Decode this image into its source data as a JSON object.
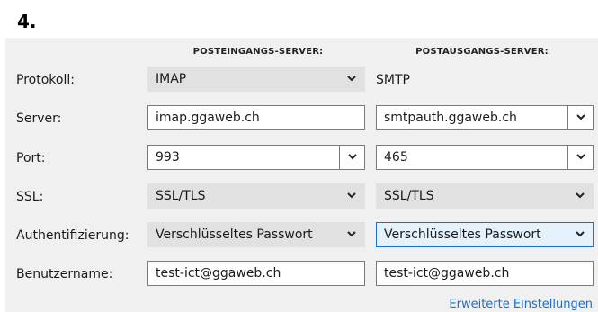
{
  "step_number": "4.",
  "headers": {
    "incoming": "POSTEINGANGS-SERVER:",
    "outgoing": "POSTAUSGANGS-SERVER:"
  },
  "rows": {
    "protocol": {
      "label": "Protokoll:",
      "incoming": "IMAP",
      "outgoing": "SMTP"
    },
    "server": {
      "label": "Server:",
      "incoming": "imap.ggaweb.ch",
      "outgoing": "smtpauth.ggaweb.ch"
    },
    "port": {
      "label": "Port:",
      "incoming": "993",
      "outgoing": "465"
    },
    "ssl": {
      "label": "SSL:",
      "incoming": "SSL/TLS",
      "outgoing": "SSL/TLS"
    },
    "auth": {
      "label": "Authentifizierung:",
      "incoming": "Verschlüsseltes Passwort",
      "outgoing": "Verschlüsseltes Passwort"
    },
    "username": {
      "label": "Benutzername:",
      "incoming": "test-ict@ggaweb.ch",
      "outgoing": "test-ict@ggaweb.ch"
    }
  },
  "advanced_link": "Erweiterte Einstellungen",
  "icons": {
    "dropdown": "chevron-down-icon"
  },
  "colors": {
    "accent": "#1a6fc9",
    "panel": "#f0f0f0",
    "select_bg": "#e1e1e1"
  }
}
